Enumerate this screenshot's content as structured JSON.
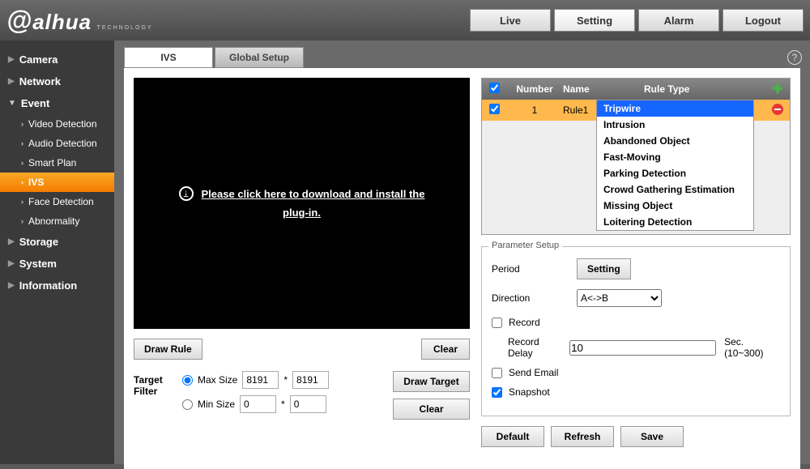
{
  "brand": {
    "name": "alhua",
    "sub": "TECHNOLOGY"
  },
  "topnav": {
    "live": "Live",
    "setting": "Setting",
    "alarm": "Alarm",
    "logout": "Logout"
  },
  "sidebar": {
    "camera": "Camera",
    "network": "Network",
    "event": "Event",
    "event_children": {
      "video_detection": "Video Detection",
      "audio_detection": "Audio Detection",
      "smart_plan": "Smart Plan",
      "ivs": "IVS",
      "face_detection": "Face Detection",
      "abnormality": "Abnormality"
    },
    "storage": "Storage",
    "system": "System",
    "information": "Information"
  },
  "tabs": {
    "ivs": "IVS",
    "global": "Global Setup"
  },
  "video": {
    "plugin_line1": "Please click here to download and install the",
    "plugin_line2": "plug-in."
  },
  "buttons": {
    "draw_rule": "Draw Rule",
    "clear": "Clear",
    "draw_target": "Draw Target",
    "setting": "Setting",
    "default": "Default",
    "refresh": "Refresh",
    "save": "Save"
  },
  "filter": {
    "label": "Target Filter",
    "max": "Max Size",
    "max_w": "8191",
    "max_h": "8191",
    "min": "Min Size",
    "min_w": "0",
    "min_h": "0",
    "star": "*"
  },
  "rules": {
    "head": {
      "number": "Number",
      "name": "Name",
      "type": "Rule Type"
    },
    "row": {
      "number": "1",
      "name": "Rule1",
      "type": "Tripwire"
    }
  },
  "dropdown": [
    "Tripwire",
    "Intrusion",
    "Abandoned Object",
    "Fast-Moving",
    "Parking Detection",
    "Crowd Gathering Estimation",
    "Missing Object",
    "Loitering Detection"
  ],
  "params": {
    "legend": "Parameter Setup",
    "period": "Period",
    "direction": "Direction",
    "direction_val": "A<->B",
    "record": "Record",
    "record_delay": "Record Delay",
    "record_delay_val": "10",
    "record_delay_unit": "Sec. (10~300)",
    "send_email": "Send Email",
    "snapshot": "Snapshot"
  }
}
